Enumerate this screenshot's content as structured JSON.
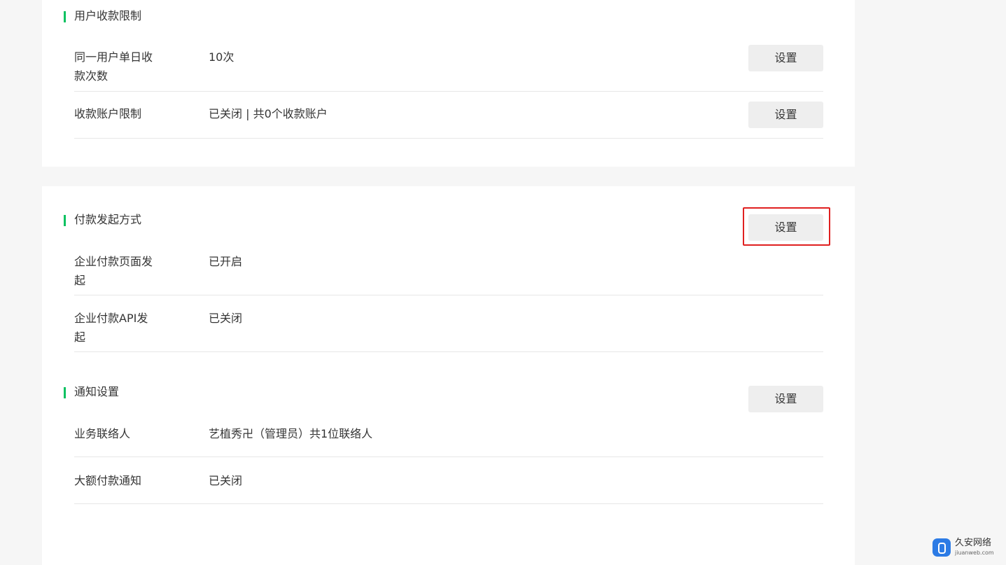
{
  "user_limit": {
    "title": "用户收款限制",
    "rows": [
      {
        "label": "同一用户单日收款次数",
        "value": "10次",
        "button": "设置"
      },
      {
        "label": "收款账户限制",
        "value": "已关闭 | 共0个收款账户",
        "button": "设置"
      }
    ]
  },
  "payment_method": {
    "title": "付款发起方式",
    "button": "设置",
    "rows": [
      {
        "label": "企业付款页面发起",
        "value": "已开启"
      },
      {
        "label": "企业付款API发起",
        "value": "已关闭"
      }
    ]
  },
  "notification": {
    "title": "通知设置",
    "button": "设置",
    "rows": [
      {
        "label": "业务联络人",
        "value": "艺植秀卍（管理员）共1位联络人"
      },
      {
        "label": "大额付款通知",
        "value": "已关闭"
      }
    ]
  },
  "watermark": {
    "name": "久安网络",
    "url": "jiuanweb.com"
  },
  "colors": {
    "accent": "#07c160",
    "highlight": "#e02020",
    "background": "#f6f6f6"
  }
}
